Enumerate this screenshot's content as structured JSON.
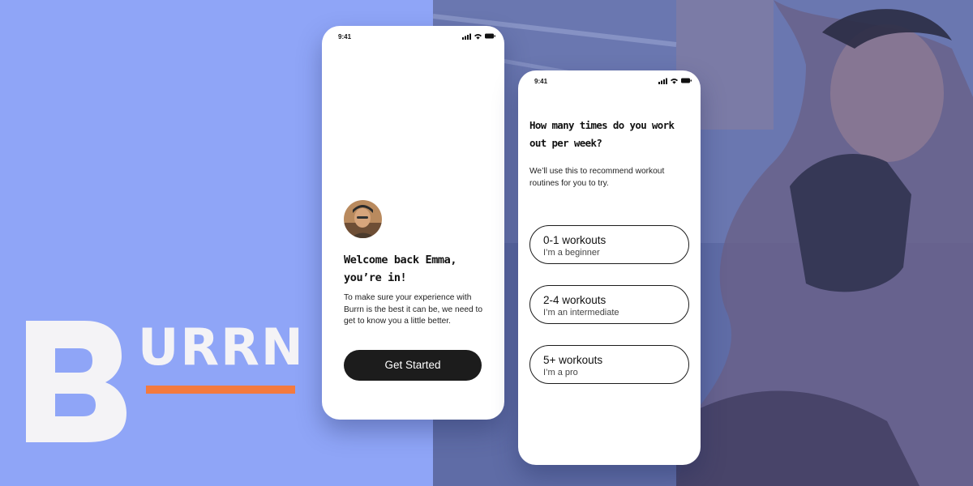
{
  "brand": {
    "logo_letter": "B",
    "logo_rest": "URRN",
    "colors": {
      "background": "#8fa5f7",
      "accent": "#f47a3e",
      "logo": "#f4f3f6"
    }
  },
  "welcome_screen": {
    "status_time": "9:41",
    "heading_line1": "Welcome back Emma,",
    "heading_line2": "you’re in!",
    "body": "To make sure your experience with Burrn is the best it can be, we need to get to know you a little better.",
    "cta_label": "Get Started"
  },
  "question_screen": {
    "status_time": "9:41",
    "question": "How many times do you work out per week?",
    "description": "We’ll use this to recommend workout routines for you to try.",
    "options": [
      {
        "title": "0-1 workouts",
        "subtitle": "I’m a beginner"
      },
      {
        "title": "2-4 workouts",
        "subtitle": "I’m an intermediate"
      },
      {
        "title": "5+ workouts",
        "subtitle": "I’m a pro"
      }
    ]
  }
}
